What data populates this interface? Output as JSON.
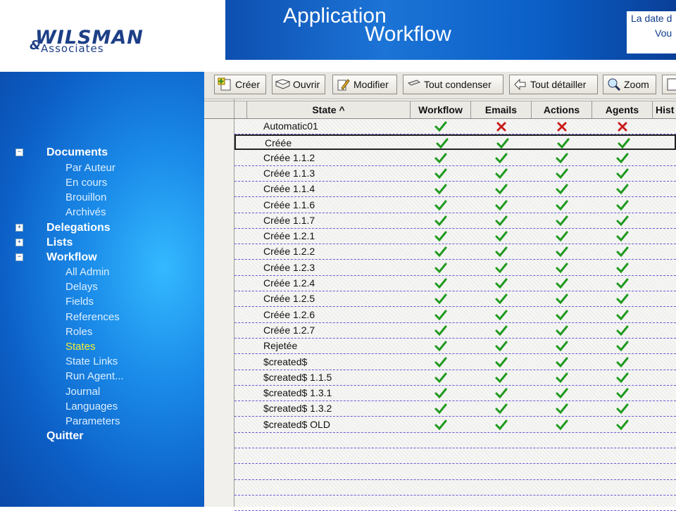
{
  "logo": {
    "main": "WILSMAN",
    "amp": "&",
    "sub": "Associates"
  },
  "banner": {
    "title_line1": "Application",
    "title_line2": "Workflow",
    "right_line1": "La date d",
    "right_line2": "Vou"
  },
  "sidebar": {
    "documents": {
      "label": "Documents",
      "toggle": "−",
      "children": [
        "Par Auteur",
        "En cours",
        "Brouillon",
        "Archivés"
      ]
    },
    "delegations": {
      "label": "Delegations",
      "toggle": "+"
    },
    "lists": {
      "label": "Lists",
      "toggle": "+"
    },
    "workflow": {
      "label": "Workflow",
      "toggle": "−",
      "children": [
        "All Admin",
        "Delays",
        "Fields",
        "References",
        "Roles",
        "States",
        "State Links",
        "Run Agent...",
        "Journal",
        "Languages",
        "Parameters"
      ],
      "active": "States"
    },
    "quit": {
      "label": "Quitter"
    }
  },
  "toolbar": {
    "create": "Créer",
    "open": "Ouvrir",
    "modify": "Modifier",
    "collapse_all": "Tout condenser",
    "expand_all": "Tout détailler",
    "zoom": "Zoom"
  },
  "grid": {
    "columns": {
      "state": "State ^",
      "workflow": "Workflow",
      "emails": "Emails",
      "actions": "Actions",
      "agents": "Agents",
      "hist": "Hist"
    },
    "rows": [
      {
        "state": "Automatic01",
        "workflow": true,
        "emails": false,
        "actions": false,
        "agents": false
      },
      {
        "state": "Créée",
        "workflow": true,
        "emails": true,
        "actions": true,
        "agents": true,
        "selected": true
      },
      {
        "state": "Créée 1.1.2",
        "workflow": true,
        "emails": true,
        "actions": true,
        "agents": true
      },
      {
        "state": "Créée 1.1.3",
        "workflow": true,
        "emails": true,
        "actions": true,
        "agents": true
      },
      {
        "state": "Créée 1.1.4",
        "workflow": true,
        "emails": true,
        "actions": true,
        "agents": true
      },
      {
        "state": "Créée 1.1.6",
        "workflow": true,
        "emails": true,
        "actions": true,
        "agents": true
      },
      {
        "state": "Créée 1.1.7",
        "workflow": true,
        "emails": true,
        "actions": true,
        "agents": true
      },
      {
        "state": "Créée 1.2.1",
        "workflow": true,
        "emails": true,
        "actions": true,
        "agents": true
      },
      {
        "state": "Créée 1.2.2",
        "workflow": true,
        "emails": true,
        "actions": true,
        "agents": true
      },
      {
        "state": "Créée 1.2.3",
        "workflow": true,
        "emails": true,
        "actions": true,
        "agents": true
      },
      {
        "state": "Créée 1.2.4",
        "workflow": true,
        "emails": true,
        "actions": true,
        "agents": true
      },
      {
        "state": "Créée 1.2.5",
        "workflow": true,
        "emails": true,
        "actions": true,
        "agents": true
      },
      {
        "state": "Créée 1.2.6",
        "workflow": true,
        "emails": true,
        "actions": true,
        "agents": true
      },
      {
        "state": "Créée 1.2.7",
        "workflow": true,
        "emails": true,
        "actions": true,
        "agents": true
      },
      {
        "state": "Rejetée",
        "workflow": true,
        "emails": true,
        "actions": true,
        "agents": true
      },
      {
        "state": "$created$",
        "workflow": true,
        "emails": true,
        "actions": true,
        "agents": true
      },
      {
        "state": "$created$ 1.1.5",
        "workflow": true,
        "emails": true,
        "actions": true,
        "agents": true
      },
      {
        "state": "$created$ 1.3.1",
        "workflow": true,
        "emails": true,
        "actions": true,
        "agents": true
      },
      {
        "state": "$created$ 1.3.2",
        "workflow": true,
        "emails": true,
        "actions": true,
        "agents": true
      },
      {
        "state": "$created$ OLD",
        "workflow": true,
        "emails": true,
        "actions": true,
        "agents": true
      }
    ]
  },
  "colors": {
    "check": "#1f9a1f",
    "cross": "#c81d1d",
    "active_nav": "#f2ee33",
    "banner": "#0d4fb0"
  }
}
